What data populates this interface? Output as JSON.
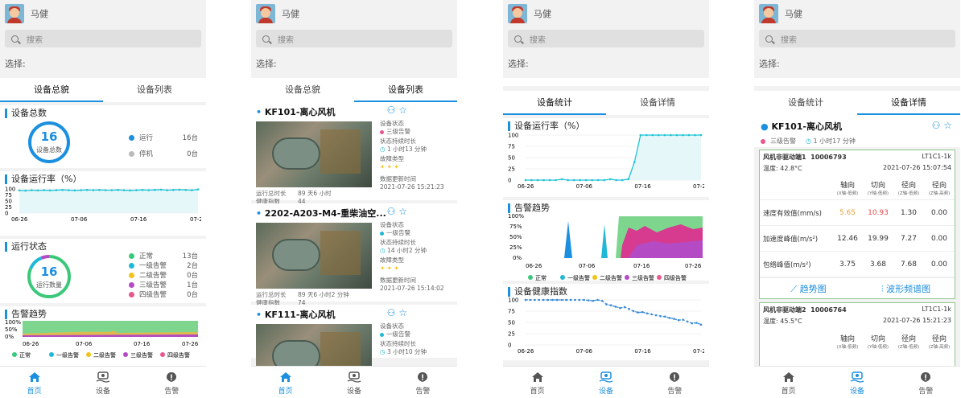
{
  "user": {
    "name": "马健"
  },
  "search": {
    "placeholder": "搜索"
  },
  "select_label": "选择:",
  "nav": {
    "home": "首页",
    "device": "设备",
    "alarm": "告警"
  },
  "s1": {
    "tabs": [
      "设备总貌",
      "设备列表"
    ],
    "total": {
      "title": "设备总数",
      "count": "16",
      "sub": "设备总数",
      "rows": [
        {
          "label": "运行",
          "value": "16台",
          "color": "#1b8fe0"
        },
        {
          "label": "停机",
          "value": "0台",
          "color": "#bbbbbb"
        }
      ]
    },
    "rate": {
      "title": "设备运行率（%）",
      "yticks": [
        "100",
        "75",
        "50",
        "25",
        "0"
      ],
      "xticks": [
        "06-26",
        "07-06",
        "07-16",
        "07-26"
      ]
    },
    "status": {
      "title": "运行状态",
      "count": "16",
      "sub": "运行数量",
      "rows": [
        {
          "label": "正常",
          "value": "13台",
          "color": "#3cc87a"
        },
        {
          "label": "一级告警",
          "value": "2台",
          "color": "#1fb8d6"
        },
        {
          "label": "二级告警",
          "value": "0台",
          "color": "#f0c419"
        },
        {
          "label": "三级告警",
          "value": "1台",
          "color": "#b44bc4"
        },
        {
          "label": "四级告警",
          "value": "0台",
          "color": "#e8578d"
        }
      ]
    },
    "trend": {
      "title": "告警趋势",
      "yticks": [
        "100%",
        "50%",
        "0%"
      ],
      "xticks": [
        "06-26",
        "07-06",
        "07-16",
        "07-26"
      ],
      "legend": [
        "正常",
        "一级告警",
        "二级告警",
        "三级告警",
        "四级告警"
      ]
    }
  },
  "s2": {
    "tabs": [
      "设备总貌",
      "设备列表"
    ],
    "devices": [
      {
        "name": "KF101-离心风机",
        "status_label": "设备状态",
        "status": "三级告警",
        "status_color": "#e8578d",
        "dur_label": "状态持续时长",
        "dur": "1 小时13 分钟",
        "fault_label": "故障类型",
        "fault": "✦ ✦ ✦",
        "run_label": "运行总时长",
        "run": "89 天6 小时",
        "health_label": "健康指数",
        "health": "44",
        "upd_label": "数据更新时间",
        "upd": "2021-07-26 15:21:23"
      },
      {
        "name": "2202-A203-M4-重柴油空...",
        "status_label": "设备状态",
        "status": "一级告警",
        "status_color": "#1fb8d6",
        "dur_label": "状态持续时长",
        "dur": "14 小时2 分钟",
        "fault_label": "故障类型",
        "fault": "✦ ✦ ✦",
        "run_label": "运行总时长",
        "run": "89 天6 小时2 分钟",
        "health_label": "健康指数",
        "health": "74",
        "upd_label": "数据更新时间",
        "upd": "2021-07-26 15:14:02"
      },
      {
        "name": "KF111-离心风机",
        "status_label": "设备状态",
        "status": "一级告警",
        "status_color": "#1fb8d6",
        "dur_label": "状态持续时长",
        "dur": "3 小时10 分钟"
      }
    ]
  },
  "s3": {
    "tabs": [
      "设备统计",
      "设备详情"
    ],
    "rate": {
      "title": "设备运行率（%）",
      "yticks": [
        "100",
        "75",
        "50",
        "25",
        "0"
      ],
      "xticks": [
        "06-26",
        "07-06",
        "07-16",
        "07-26"
      ]
    },
    "trend": {
      "title": "告警趋势",
      "yticks": [
        "100%",
        "75%",
        "50%",
        "25%",
        "0%"
      ],
      "xticks": [
        "06-26",
        "07-06",
        "07-16",
        "07-26"
      ],
      "legend": [
        "正常",
        "一级告警",
        "二级告警",
        "三级告警",
        "四级告警"
      ]
    },
    "health": {
      "title": "设备健康指数",
      "yticks": [
        "100",
        "75",
        "50",
        "25",
        "0"
      ],
      "xticks": [
        "06-26",
        "07-06",
        "07-16",
        "07-26"
      ]
    }
  },
  "s4": {
    "tabs": [
      "设备统计",
      "设备详情"
    ],
    "device": "KF101-离心风机",
    "status": "三级告警",
    "dur": "1 小时17 分钟",
    "sensors": [
      {
        "name": "风机非驱动端1",
        "id": "10006793",
        "code": "LT1C1-1k",
        "temp": "温度:  42.8°C",
        "time": "2021-07-26 15:07:54",
        "cols": [
          {
            "h": "轴向",
            "s": "(X轴-低频)"
          },
          {
            "h": "切向",
            "s": "(Y轴-低频)"
          },
          {
            "h": "径向",
            "s": "(Z轴-低频)"
          },
          {
            "h": "径向",
            "s": "(Z轴-高频)"
          }
        ],
        "rows": [
          {
            "label": "速度有效值(mm/s)",
            "v": [
              "5.65",
              "10.93",
              "1.30",
              "0.00"
            ],
            "c": [
              "#e6a23c",
              "#e84a4a",
              "#333",
              "#333"
            ]
          },
          {
            "label": "加速度峰值(m/s²)",
            "v": [
              "12.46",
              "19.99",
              "7.27",
              "0.00"
            ],
            "c": [
              "#333",
              "#333",
              "#333",
              "#333"
            ]
          },
          {
            "label": "包络峰值(m/s²)",
            "v": [
              "3.75",
              "3.68",
              "7.68",
              "0.00"
            ],
            "c": [
              "#333",
              "#333",
              "#333",
              "#333"
            ]
          }
        ],
        "btn1": "趋势图",
        "btn2": "波形频谱图"
      },
      {
        "name": "风机非驱动端2",
        "id": "10006764",
        "code": "LT1C1-1k",
        "temp": "温度:  45.5°C",
        "time": "2021-07-26 15:21:23",
        "cols": [
          {
            "h": "轴向",
            "s": "(X轴-低频)"
          },
          {
            "h": "切向",
            "s": "(Y轴-低频)"
          },
          {
            "h": "径向",
            "s": "(Z轴-低频)"
          },
          {
            "h": "径向",
            "s": "(Z轴-高频)"
          }
        ]
      }
    ]
  },
  "chart_data": [
    {
      "type": "line",
      "title": "设备运行率（%）",
      "x": [
        "06-26",
        "07-06",
        "07-16",
        "07-26"
      ],
      "ylim": [
        0,
        100
      ],
      "series": [
        {
          "values": [
            94,
            93,
            95,
            94,
            95,
            94,
            95,
            96,
            95,
            94,
            95,
            96,
            95,
            96,
            95,
            95,
            96,
            95,
            94,
            95,
            96,
            95,
            96,
            97,
            95,
            96,
            97,
            96,
            95,
            98
          ]
        }
      ]
    },
    {
      "type": "line",
      "title": "设备运行率（%）",
      "x": [
        "06-26",
        "07-06",
        "07-16",
        "07-26"
      ],
      "ylim": [
        0,
        100
      ],
      "series": [
        {
          "values": [
            0,
            0,
            0,
            0,
            0,
            0,
            2,
            0,
            0,
            0,
            0,
            0,
            0,
            0,
            2,
            0,
            0,
            2,
            40,
            100,
            100,
            100,
            100,
            100,
            100,
            100,
            100,
            100,
            100,
            100
          ]
        }
      ]
    },
    {
      "type": "line",
      "title": "设备健康指数",
      "x": [
        "06-26",
        "07-06",
        "07-16",
        "07-26"
      ],
      "ylim": [
        0,
        100
      ],
      "series": [
        {
          "values": [
            100,
            100,
            100,
            100,
            100,
            100,
            100,
            100,
            100,
            100,
            100,
            100,
            100,
            100,
            99,
            98,
            100,
            98,
            90,
            88,
            85,
            82,
            84,
            80,
            75,
            72,
            73,
            70,
            68,
            66,
            64,
            63,
            60,
            58,
            55,
            56,
            52,
            48,
            49,
            45
          ]
        }
      ]
    }
  ]
}
